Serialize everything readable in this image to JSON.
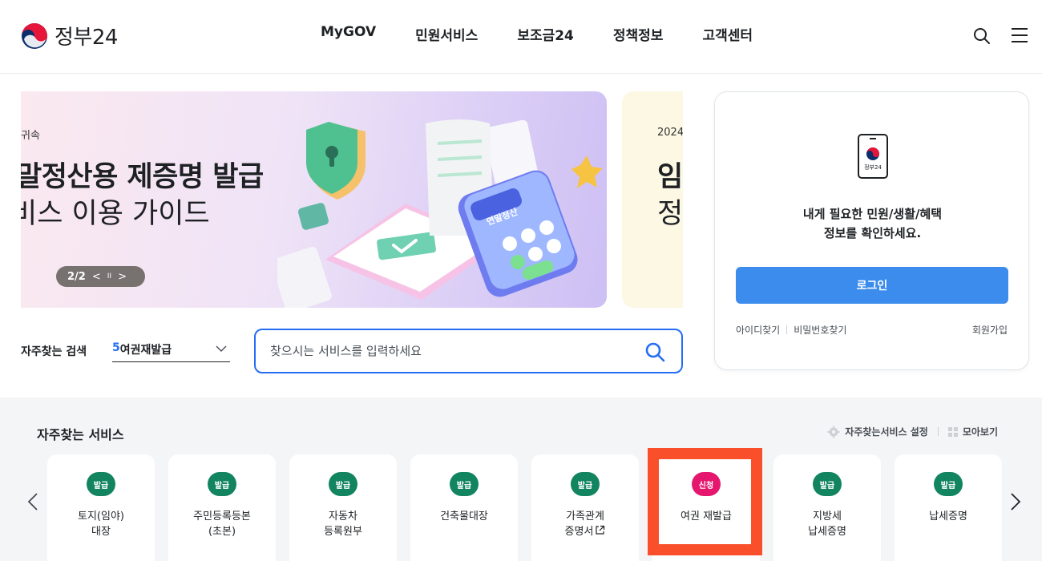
{
  "header": {
    "logo_text": "정부24",
    "nav": [
      "MyGOV",
      "민원서비스",
      "보조금24",
      "정책정보",
      "고객센터"
    ]
  },
  "banner": {
    "category": "귀속",
    "title": "말정산용 제증명 발급",
    "subtitle": "비스 이용 가이드",
    "pager_text": "2/2",
    "pager_prev": "<",
    "pager_pause": "II",
    "pager_next": ">",
    "illustration_label": "연말정산",
    "next_slide": {
      "year": "2024",
      "title_char": "임",
      "sub_char": "정"
    }
  },
  "search": {
    "freq_label": "자주찾는 검색",
    "freq_rank": "5",
    "freq_value": "여권재발급",
    "placeholder": "찾으시는 서비스를 입력하세요"
  },
  "login": {
    "icon_caption": "정부24",
    "message_line1": "내게 필요한 민원/생활/혜택",
    "message_line2": "정보를 확인하세요.",
    "login_button": "로그인",
    "find_id": "아이디찾기",
    "find_pw": "비밀번호찾기",
    "signup": "회원가입"
  },
  "services": {
    "title": "자주찾는 서비스",
    "settings_label": "자주찾는서비스 설정",
    "view_all_label": "모아보기",
    "items": [
      {
        "badge": "발급",
        "line1": "토지(임야)",
        "line2": "대장",
        "badge_color": "#12845f"
      },
      {
        "badge": "발급",
        "line1": "주민등록등본",
        "line2": "(초본)",
        "badge_color": "#12845f"
      },
      {
        "badge": "발급",
        "line1": "자동차",
        "line2": "등록원부",
        "badge_color": "#12845f"
      },
      {
        "badge": "발급",
        "line1": "건축물대장",
        "line2": "",
        "badge_color": "#12845f"
      },
      {
        "badge": "발급",
        "line1": "가족관계",
        "line2": "증명서",
        "badge_color": "#12845f",
        "external": true
      },
      {
        "badge": "신청",
        "line1": "여권 재발급",
        "line2": "",
        "badge_color": "#e5166d"
      },
      {
        "badge": "발급",
        "line1": "지방세",
        "line2": "납세증명",
        "badge_color": "#12845f"
      },
      {
        "badge": "발급",
        "line1": "납세증명",
        "line2": "",
        "badge_color": "#12845f"
      }
    ]
  },
  "colors": {
    "primary": "#256ef4",
    "login_button": "#3b8ced",
    "issue_badge": "#12845f",
    "apply_badge": "#e5166d",
    "highlight_box": "#fa4f2b"
  }
}
